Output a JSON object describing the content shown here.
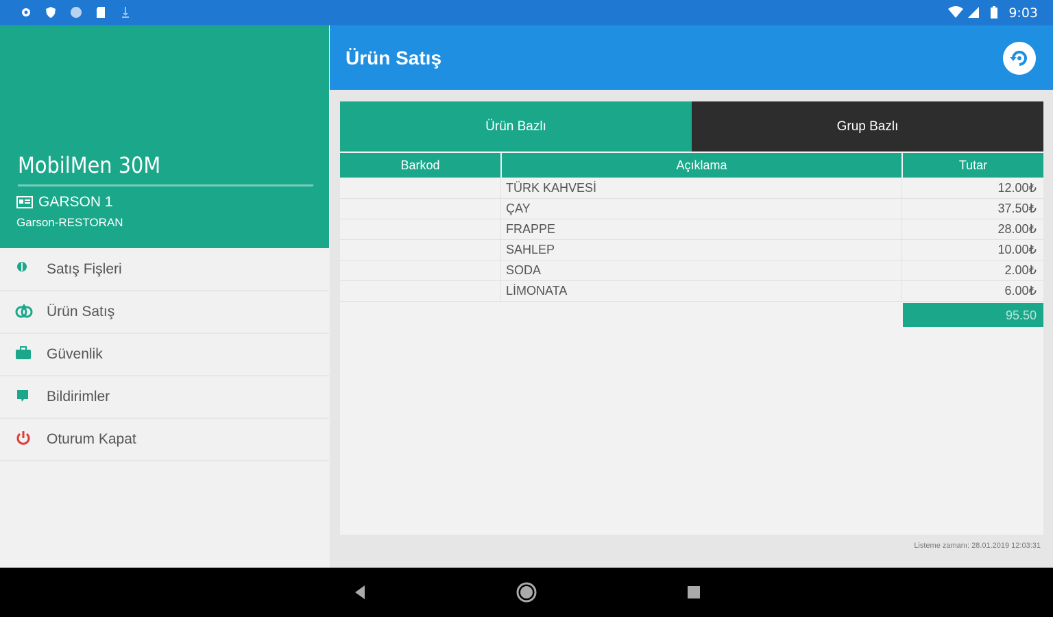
{
  "status_bar": {
    "time": "9:03"
  },
  "sidebar": {
    "app_name": "MobilMen 30M",
    "user_name": "GARSON 1",
    "user_role": "Garson-RESTORAN",
    "items": [
      {
        "label": "Satış Fişleri",
        "icon": "receipt-icon"
      },
      {
        "label": "Ürün Satış",
        "icon": "products-icon"
      },
      {
        "label": "Güvenlik",
        "icon": "briefcase-icon"
      },
      {
        "label": "Bildirimler",
        "icon": "notification-icon"
      },
      {
        "label": "Oturum Kapat",
        "icon": "power-icon"
      }
    ]
  },
  "toolbar": {
    "title": "Ürün Satış"
  },
  "tabs": [
    {
      "label": "Ürün Bazlı"
    },
    {
      "label": "Grup Bazlı"
    }
  ],
  "table": {
    "headers": {
      "barcode": "Barkod",
      "description": "Açıklama",
      "amount": "Tutar"
    },
    "rows": [
      {
        "barcode": "",
        "description": "TÜRK KAHVESİ",
        "amount": "12.00₺"
      },
      {
        "barcode": "",
        "description": "ÇAY",
        "amount": "37.50₺"
      },
      {
        "barcode": "",
        "description": "FRAPPE",
        "amount": "28.00₺"
      },
      {
        "barcode": "",
        "description": "SAHLEP",
        "amount": "10.00₺"
      },
      {
        "barcode": "",
        "description": "SODA",
        "amount": "2.00₺"
      },
      {
        "barcode": "",
        "description": "LİMONATA",
        "amount": "6.00₺"
      }
    ],
    "total": "95.50"
  },
  "footer": {
    "note": "Listeme zamanı: 28.01.2019 12:03:31"
  },
  "colors": {
    "teal": "#1ba88a",
    "blue": "#1e8fe1",
    "dark": "#2d2d2d"
  }
}
